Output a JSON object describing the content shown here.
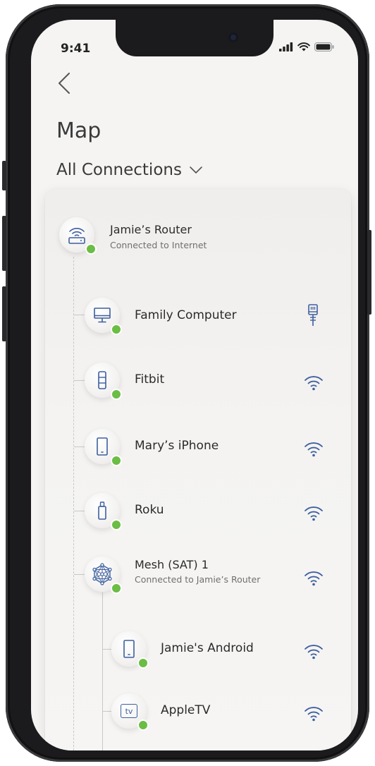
{
  "status_bar": {
    "time": "9:41"
  },
  "header": {
    "title": "Map",
    "filter_label": "All Connections"
  },
  "router": {
    "name": "Jamie’s Router",
    "status": "Connected to Internet"
  },
  "devices": [
    {
      "name": "Family Computer",
      "icon": "desktop-icon",
      "connection": "ethernet-icon"
    },
    {
      "name": "Fitbit",
      "icon": "wearable-icon",
      "connection": "wifi-icon"
    },
    {
      "name": "Mary’s iPhone",
      "icon": "phone-icon",
      "connection": "wifi-icon"
    },
    {
      "name": "Roku",
      "icon": "streaming-stick-icon",
      "connection": "wifi-icon"
    },
    {
      "name": "Mesh (SAT) 1",
      "status": "Connected to Jamie’s Router",
      "icon": "mesh-node-icon",
      "connection": "wifi-icon"
    }
  ],
  "mesh_devices": [
    {
      "name": "Jamie's Android",
      "icon": "phone-icon",
      "connection": "wifi-icon"
    },
    {
      "name": "AppleTV",
      "icon": "tv-icon",
      "icon_text": "tv",
      "connection": "wifi-icon"
    }
  ],
  "colors": {
    "accent": "#3d6fb0",
    "online": "#6bbd45",
    "icon": "#3d5f9e"
  }
}
